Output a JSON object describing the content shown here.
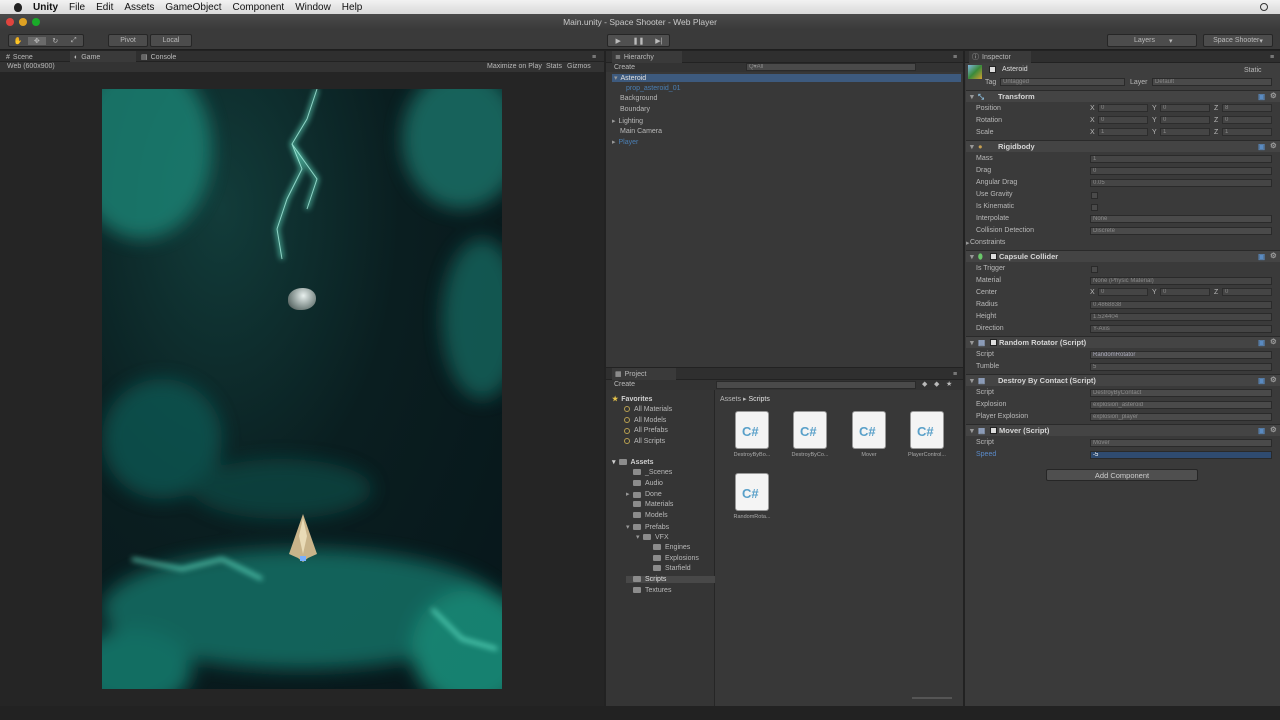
{
  "menubar": {
    "apple": "",
    "items": [
      "Unity",
      "File",
      "Edit",
      "Assets",
      "GameObject",
      "Component",
      "Window",
      "Help"
    ]
  },
  "window": {
    "title": "Main.unity - Space Shooter - Web Player"
  },
  "toolbar": {
    "pivot": "Pivot",
    "local": "Local",
    "layers": "Layers",
    "layout": "Space Shooter"
  },
  "scene_tabs": {
    "scene": "Scene",
    "game": "Game",
    "console": "Console",
    "resolution": "Web (600x900)",
    "maximize": "Maximize on Play",
    "stats": "Stats",
    "gizmos": "Gizmos"
  },
  "hierarchy": {
    "title": "Hierarchy",
    "create": "Create",
    "search": "Q▾All",
    "items": [
      {
        "label": "Asteroid",
        "color": "#e0e0e0"
      },
      {
        "label": "prop_asteroid_01",
        "color": "#4a7fb4"
      },
      {
        "label": "Background",
        "color": "#b9b9b9"
      },
      {
        "label": "Boundary",
        "color": "#b9b9b9"
      },
      {
        "label": "Lighting",
        "color": "#b9b9b9"
      },
      {
        "label": "Main Camera",
        "color": "#b9b9b9"
      },
      {
        "label": "Player",
        "color": "#4a7fb4"
      }
    ]
  },
  "project": {
    "title": "Project",
    "create": "Create",
    "favorites": "Favorites",
    "fav_items": [
      "All Materials",
      "All Models",
      "All Prefabs",
      "All Scripts"
    ],
    "assets": "Assets",
    "folders": [
      "_Scenes",
      "Audio",
      "Done",
      "Materials",
      "Models",
      "Prefabs",
      "VFX",
      "Engines",
      "Explosions",
      "Starfield",
      "Scripts",
      "Textures"
    ],
    "breadcrumb": [
      "Assets",
      "Scripts"
    ],
    "files": [
      "DestroyByBo...",
      "DestroyByCo...",
      "Mover",
      "PlayerControl...",
      "RandomRota..."
    ]
  },
  "inspector": {
    "title": "Inspector",
    "object_name": "Asteroid",
    "static": "Static",
    "tag_label": "Tag",
    "tag": "Untagged",
    "layer_label": "Layer",
    "layer": "Default",
    "transform": {
      "title": "Transform",
      "position": "Position",
      "rotation": "Rotation",
      "scale": "Scale",
      "pos": [
        "0",
        "0",
        "8"
      ],
      "rot": [
        "0",
        "0",
        "0"
      ],
      "scl": [
        "1",
        "1",
        "1"
      ]
    },
    "rigidbody": {
      "title": "Rigidbody",
      "labels": [
        "Mass",
        "Drag",
        "Angular Drag",
        "Use Gravity",
        "Is Kinematic",
        "Interpolate",
        "Collision Detection",
        "Constraints"
      ],
      "values": [
        "1",
        "0",
        "0.05",
        "",
        "",
        "None",
        "Discrete",
        ""
      ]
    },
    "capsule": {
      "title": "Capsule Collider",
      "labels": [
        "Is Trigger",
        "Material",
        "Center",
        "Radius",
        "Height",
        "Direction"
      ],
      "values": [
        "",
        "None (Physic Material)",
        "",
        "0.4868838",
        "1.524404",
        "Y-Axis"
      ],
      "center": [
        "0",
        "0",
        "0"
      ]
    },
    "random_rotator": {
      "title": "Random Rotator (Script)",
      "labels": [
        "Script",
        "Tumble"
      ],
      "values": [
        "RandomRotator",
        "5"
      ]
    },
    "destroy_contact": {
      "title": "Destroy By Contact (Script)",
      "labels": [
        "Script",
        "Explosion",
        "Player Explosion"
      ],
      "values": [
        "DestroyByContact",
        "explosion_asteroid",
        "explosion_player"
      ]
    },
    "mover": {
      "title": "Mover (Script)",
      "labels": [
        "Script",
        "Speed"
      ],
      "values": [
        "Mover",
        "-5"
      ]
    },
    "add_component": "Add Component"
  },
  "axes": {
    "x": "X",
    "y": "Y",
    "z": "Z"
  },
  "colors": {
    "nebula": "#1fb79a",
    "space": "#0a1a1c",
    "accent": "#4a7fb4"
  }
}
